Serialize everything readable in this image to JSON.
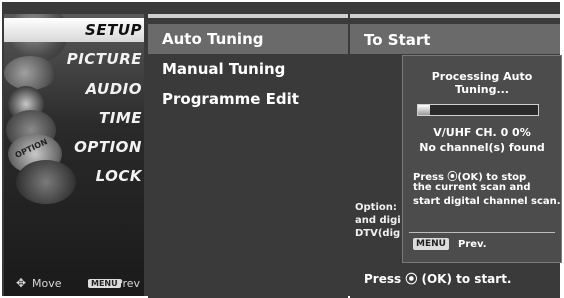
{
  "left_menu": {
    "items": [
      {
        "label": "SETUP",
        "selected": true
      },
      {
        "label": "PICTURE",
        "selected": false
      },
      {
        "label": "AUDIO",
        "selected": false
      },
      {
        "label": "TIME",
        "selected": false
      },
      {
        "label": "OPTION",
        "selected": false
      },
      {
        "label": "LOCK",
        "selected": false
      }
    ],
    "hint_move": "Move",
    "hint_menu_key": "MENU",
    "hint_prev": "Prev",
    "deco_texts": [
      "OPTION"
    ]
  },
  "sub_menu": {
    "items": [
      "Auto Tuning",
      "Manual Tuning",
      "Programme Edit"
    ],
    "selected_index": 0
  },
  "right_panel": {
    "title": "To Start",
    "bg_text_lines": [
      "Option:",
      "and digi",
      "DTV(dig"
    ],
    "bottom_text": "Press ⦿ (OK) to start."
  },
  "popup": {
    "title": "Processing Auto Tuning...",
    "progress": 0.1,
    "channel_line": "V/UHF CH. 0  0%",
    "found_line": "No channel(s) found",
    "message_lines": [
      "Press  ⦿(OK) to stop",
      "the current scan and",
      "start digital channel scan."
    ],
    "menu_key": "MENU",
    "prev": "Prev."
  }
}
